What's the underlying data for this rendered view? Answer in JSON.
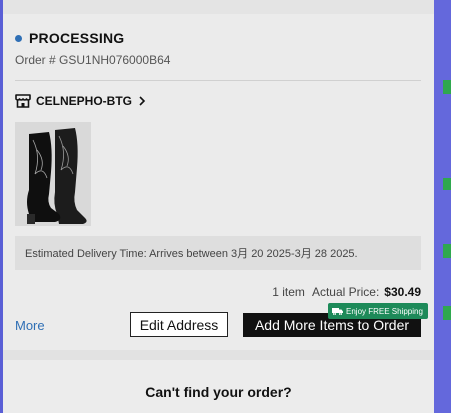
{
  "order": {
    "status": "PROCESSING",
    "number_text": "Order # GSU1NH076000B64"
  },
  "store": {
    "name": "CELNEPHO-BTG",
    "icon": "store-icon"
  },
  "product": {
    "image": "black-embroidered-western-boots"
  },
  "delivery": {
    "text": "Estimated Delivery Time: Arrives between 3月 20 2025-3月 28 2025."
  },
  "summary": {
    "items_count": "1 item",
    "actual_label": "Actual Price:",
    "actual_value": "$30.49"
  },
  "actions": {
    "more_label": "More",
    "edit_address_label": "Edit Address",
    "add_more_label": "Add More Items to Order",
    "shipping_badge": "Enjoy FREE Shipping"
  },
  "footer": {
    "cant_find": "Can't find your order?"
  },
  "colors": {
    "status_dot": "#2f6fb5",
    "link": "#2f6fb5",
    "badge": "#1d8a59",
    "primary_button": "#111111",
    "side_bar": "#6468dc"
  }
}
